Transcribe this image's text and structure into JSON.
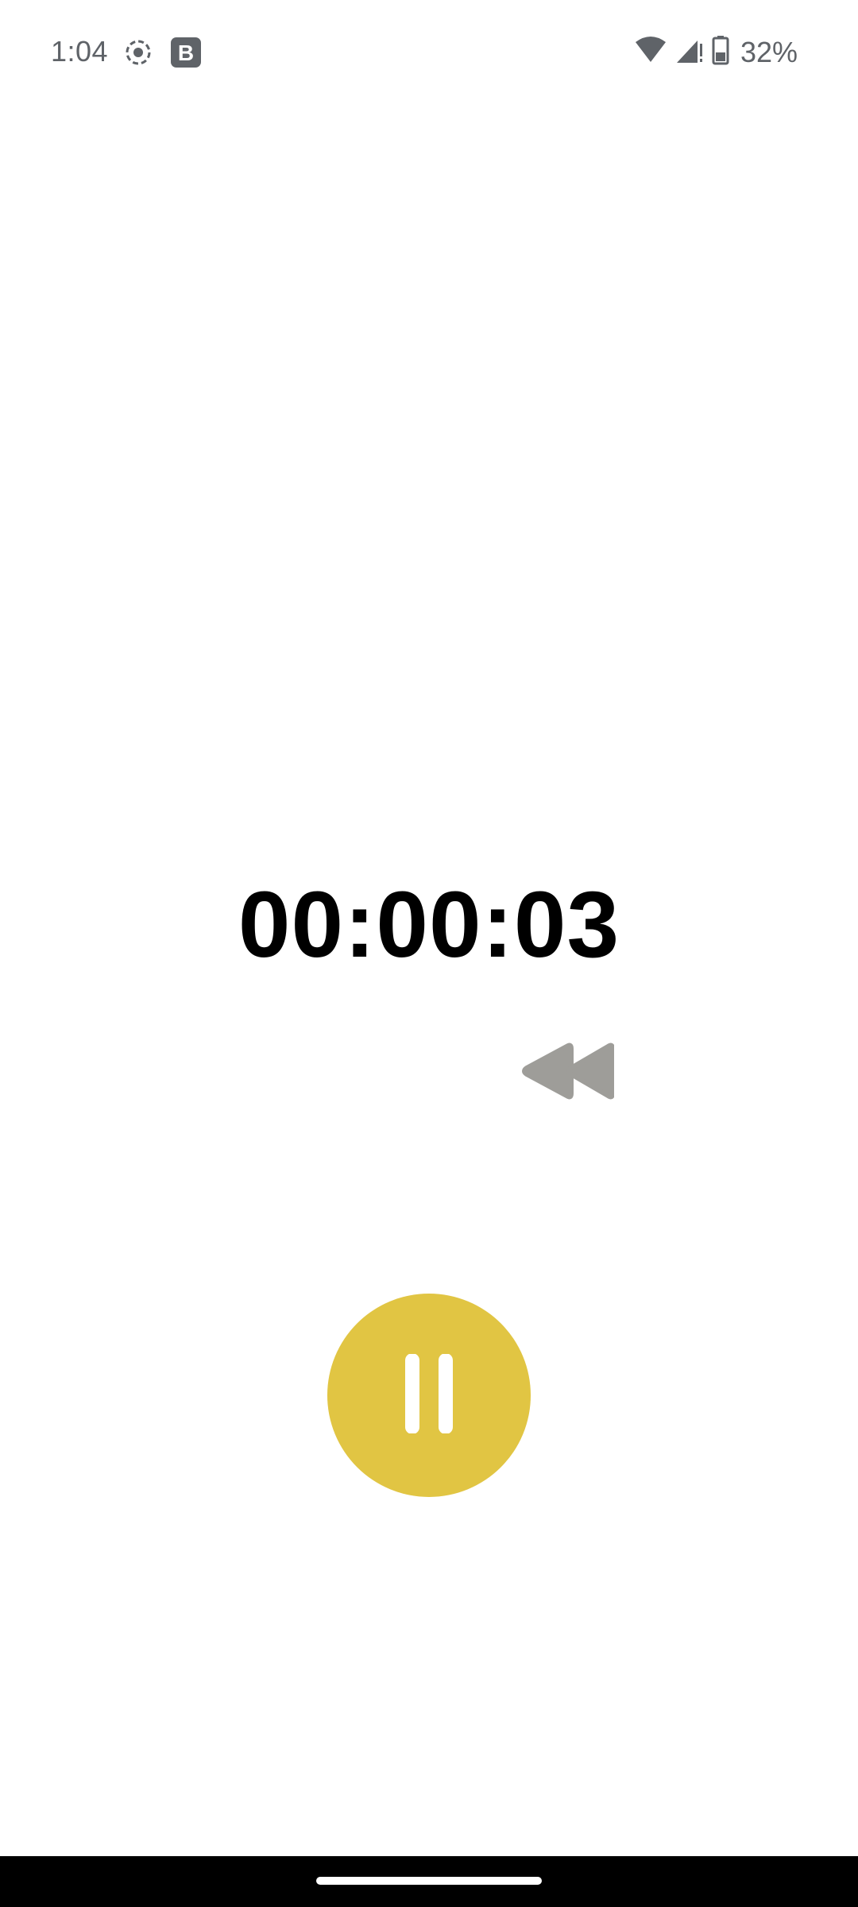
{
  "status_bar": {
    "time": "1:04",
    "battery_percent": "32%",
    "icons": [
      "screen-record-icon",
      "b-app-icon",
      "wifi-icon",
      "signal-icon",
      "battery-icon"
    ]
  },
  "stopwatch": {
    "elapsed": "00:00:03",
    "state": "running"
  },
  "controls": {
    "reset_icon": "rewind-icon",
    "primary_icon": "pause-icon",
    "primary_color": "#e1c543",
    "secondary_color": "#9e9d99"
  }
}
